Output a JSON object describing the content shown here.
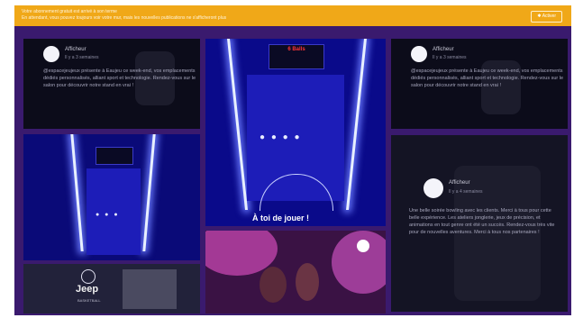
{
  "banner": {
    "line1": "Votre abonnement gratuit est arrivé à son terme",
    "line2": "En attendant, vous pouvez toujours voir votre mur, mais les nouvelles publications ne s'afficheront plus",
    "button_label": "✱ Activer"
  },
  "cards": [
    {
      "name": "Afficheur",
      "date": "Il y a 3 semaines",
      "text": "@espacejeujeux présente à Eaujeu ce week-end, vos emplacements dédiés personnalisés, alliant sport et technologie. Rendez-vous sur le salon pour découvrir notre stand en vrai !"
    },
    {
      "name": "Afficheur",
      "date": "Il y a 3 semaines",
      "text": "@espacejeujeux présente à Eaujeu ce week-end, vos emplacements dédiés personnalisés, alliant sport et technologie. Rendez-vous sur le salon pour découvrir notre stand en vrai !"
    },
    {
      "name": "Afficheur",
      "date": "Il y a 4 semaines",
      "text": "Une belle soirée bowling avec les clients. Merci à tous pour cette belle expérience. Les ateliers jonglerie, jeux de précision, et animations en tout genre ont été un succès. Rendez-vous très vite pour de nouvelles aventures. Merci à tous nos partenaires !"
    }
  ],
  "court": {
    "caption": "À toi de jouer !",
    "score_label": "6 Balls"
  },
  "jeep": {
    "logo": "Jeep",
    "sub": "BASKETBALL"
  },
  "colors": {
    "background": "#3a1a6e",
    "banner": "#f0a818",
    "court": "#0a0a8a",
    "party": "#c83aa8"
  }
}
